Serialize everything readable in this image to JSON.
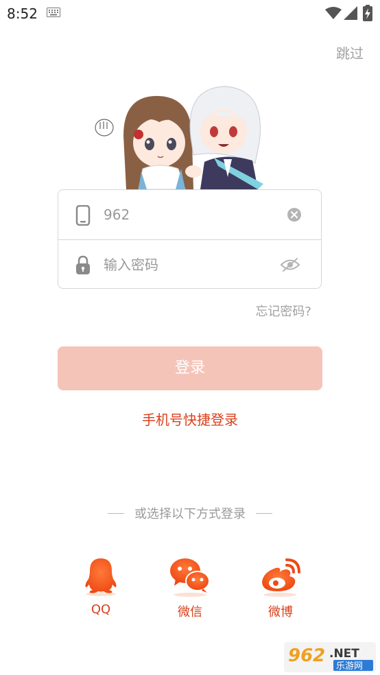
{
  "status_bar": {
    "time": "8:52"
  },
  "header": {
    "skip_label": "跳过"
  },
  "form": {
    "phone_value": "962",
    "password_placeholder": "输入密码"
  },
  "forgot_password_label": "忘记密码?",
  "login_button_label": "登录",
  "quick_login_label": "手机号快捷登录",
  "alt_login": {
    "title": "或选择以下方式登录",
    "options": [
      {
        "label": "QQ",
        "icon": "qq-icon"
      },
      {
        "label": "微信",
        "icon": "wechat-icon"
      },
      {
        "label": "微博",
        "icon": "weibo-icon"
      }
    ]
  },
  "watermark": {
    "number": "962",
    "suffix": ".NET",
    "subtitle": "乐游网"
  },
  "colors": {
    "accent": "#d9401c",
    "login_button": "#f5c4b9",
    "muted_text": "#a0a0a0",
    "border": "#d6d6d6"
  }
}
